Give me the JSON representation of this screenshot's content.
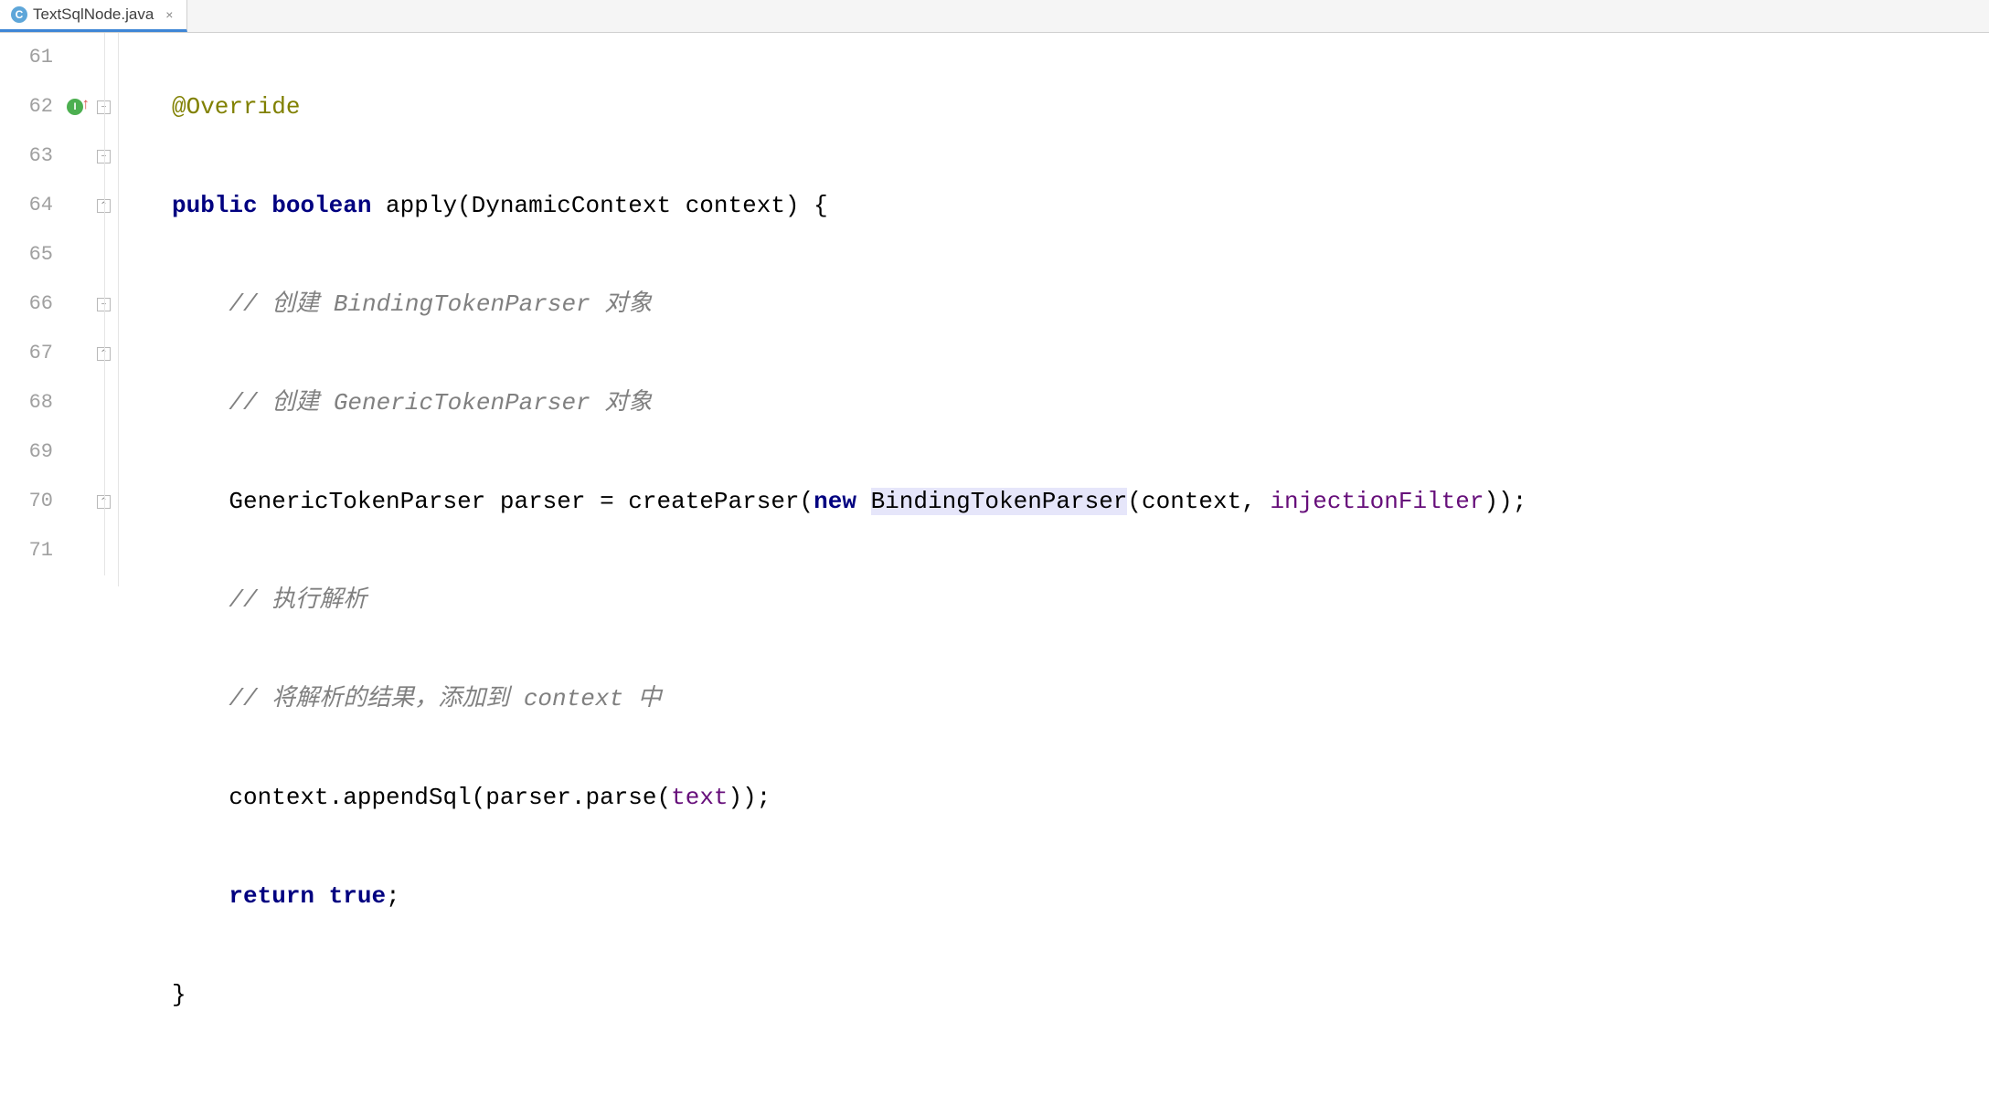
{
  "tab": {
    "filename": "TextSqlNode.java",
    "icon_letter": "C"
  },
  "lines": {
    "l61": {
      "num": "61"
    },
    "l62": {
      "num": "62"
    },
    "l63": {
      "num": "63"
    },
    "l64": {
      "num": "64"
    },
    "l65": {
      "num": "65"
    },
    "l66": {
      "num": "66"
    },
    "l67": {
      "num": "67"
    },
    "l68": {
      "num": "68"
    },
    "l69": {
      "num": "69"
    },
    "l70": {
      "num": "70"
    },
    "l71": {
      "num": "71"
    }
  },
  "code": {
    "l61_annotation": "@Override",
    "l62_public": "public",
    "l62_boolean": "boolean",
    "l62_rest": " apply(DynamicContext context) {",
    "l63_comment": "// 创建 BindingTokenParser 对象",
    "l64_comment": "// 创建 GenericTokenParser 对象",
    "l65_pre": "GenericTokenParser parser = createParser(",
    "l65_new": "new",
    "l65_space": " ",
    "l65_highlight": "BindingTokenParser",
    "l65_mid": "(context, ",
    "l65_param": "injectionFilter",
    "l65_end": "));",
    "l66_comment": "// 执行解析",
    "l67_comment": "// 将解析的结果，添加到 context 中",
    "l68_pre": "context.appendSql(parser.parse(",
    "l68_param": "text",
    "l68_end": "));",
    "l69_return": "return",
    "l69_space": " ",
    "l69_true": "true",
    "l69_semi": ";",
    "l70_brace": "}"
  },
  "marks": {
    "l62_green": "I",
    "l62_arrow": "↑"
  }
}
